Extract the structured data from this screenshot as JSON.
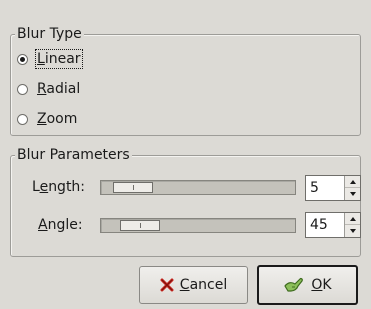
{
  "blur_type": {
    "legend": "Blur Type",
    "options": [
      {
        "prefix": "",
        "mnemonic": "L",
        "rest": "inear",
        "selected": true
      },
      {
        "prefix": "",
        "mnemonic": "R",
        "rest": "adial",
        "selected": false
      },
      {
        "prefix": "",
        "mnemonic": "Z",
        "rest": "oom",
        "selected": false
      }
    ]
  },
  "blur_parameters": {
    "legend": "Blur Parameters",
    "length": {
      "prefix": "L",
      "mnemonic": "e",
      "rest": "ngth:",
      "value": "5",
      "slider_fraction": 0.08
    },
    "angle": {
      "prefix": "",
      "mnemonic": "A",
      "rest": "ngle:",
      "value": "45",
      "slider_fraction": 0.125
    }
  },
  "buttons": {
    "cancel": {
      "prefix": "",
      "mnemonic": "C",
      "rest": "ancel",
      "icon": "cancel-x-icon"
    },
    "ok": {
      "prefix": "",
      "mnemonic": "O",
      "rest": "K",
      "icon": "ok-hand-icon"
    }
  },
  "colors": {
    "window_bg": "#dcdad5",
    "cancel_icon": "#c8231c",
    "ok_icon": "#6a9a3c"
  }
}
